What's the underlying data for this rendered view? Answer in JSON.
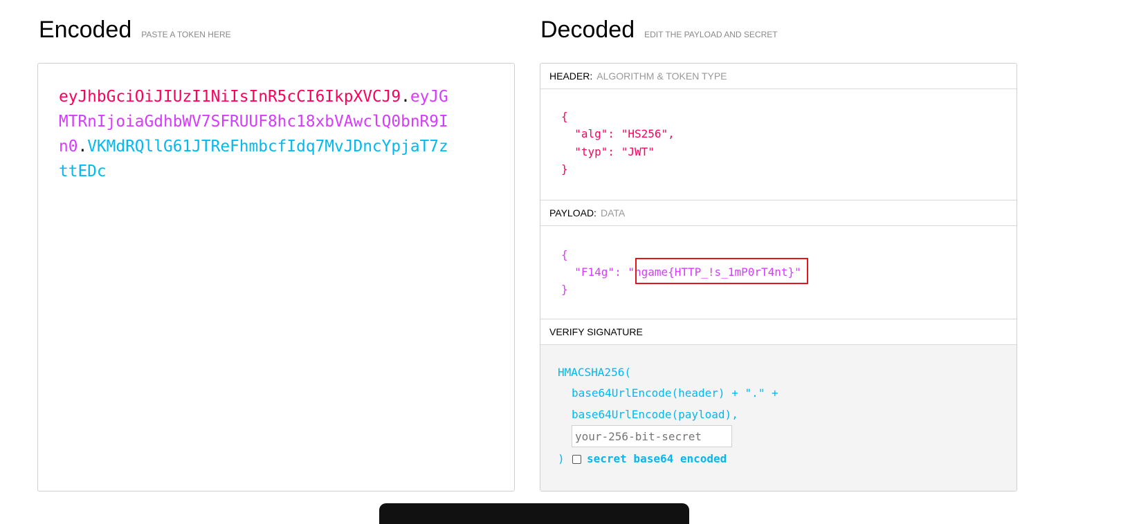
{
  "encoded": {
    "title": "Encoded",
    "subtitle": "PASTE A TOKEN HERE",
    "token_header": "eyJhbGciOiJIUzI1NiIsInR5cCI6IkpXVCJ9",
    "dot1": ".",
    "token_payload": "eyJGMTRnIjoiaGdhbWV7SFRUUF8hc18xbVAwclQ0bnR9In0",
    "dot2": ".",
    "token_signature": "VKMdRQllG61JTReFhmbcfIdq7MvJDncYpjaT7zttEDc"
  },
  "decoded": {
    "title": "Decoded",
    "subtitle": "EDIT THE PAYLOAD AND SECRET",
    "header": {
      "title": "HEADER:",
      "desc": "ALGORITHM & TOKEN TYPE",
      "lines": [
        "{",
        "  \"alg\": \"HS256\",",
        "  \"typ\": \"JWT\"",
        "}"
      ]
    },
    "payload": {
      "title": "PAYLOAD:",
      "desc": "DATA",
      "lines": [
        "{",
        "  \"F14g\": \"hgame{HTTP_!s_1mP0rT4nt}\"",
        "}"
      ]
    },
    "signature": {
      "title": "VERIFY SIGNATURE",
      "line1": "HMACSHA256(",
      "line2": "base64UrlEncode(header) + \".\" +",
      "line3": "base64UrlEncode(payload),",
      "secret_placeholder": "your-256-bit-secret",
      "close": ")",
      "checkbox_label": "secret base64 encoded"
    }
  },
  "colors": {
    "header": "#fb015b",
    "payload": "#d63aff",
    "signature": "#00b9f1",
    "highlight": "#e0161b"
  }
}
